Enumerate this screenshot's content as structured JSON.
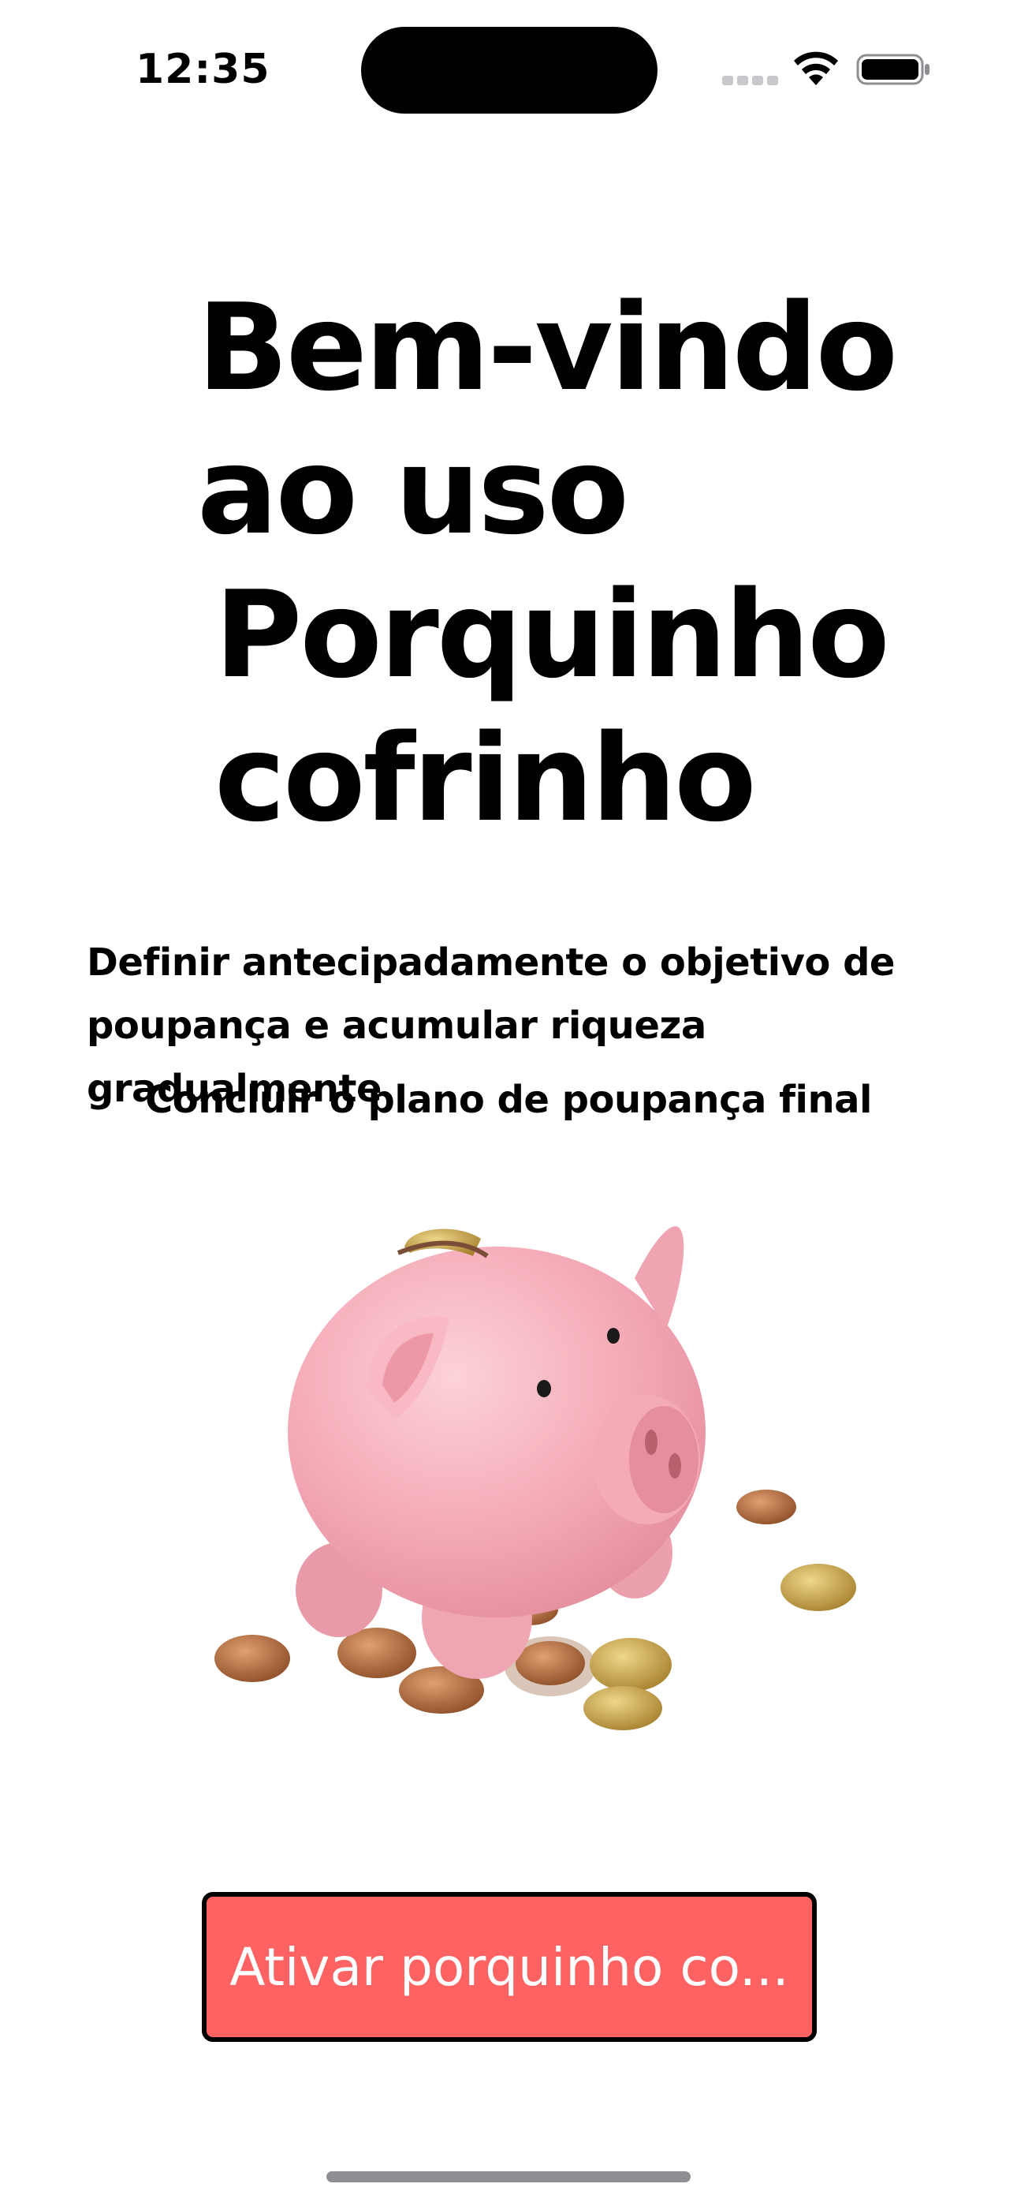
{
  "status_bar": {
    "time": "12:35",
    "icons": [
      "cellular-signal-icon",
      "wifi-icon",
      "battery-icon"
    ]
  },
  "welcome": {
    "title_lines": [
      "Bem-vindo",
      "ao uso",
      "Porquinho",
      "cofrinho"
    ],
    "description": "Definir antecipadamente o objetivo de poupança e acumular riqueza gradualmente",
    "final_plan": "Concluir o plano de poupança final"
  },
  "illustration": {
    "subject": "piggy-bank-with-coins"
  },
  "cta": {
    "label": "Ativar porquinho co..."
  },
  "colors": {
    "accent": "#ff6262",
    "piggy": "#f7b3bf",
    "coin_copper": "#b46a3c",
    "coin_gold": "#c9a84a"
  }
}
